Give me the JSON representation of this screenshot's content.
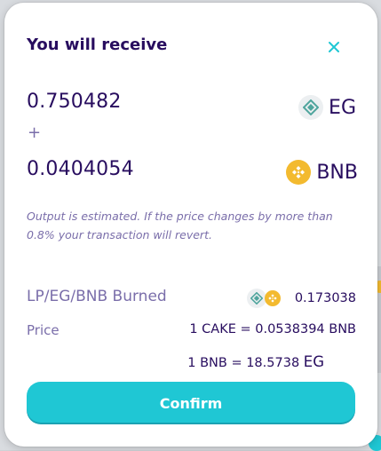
{
  "modal": {
    "title": "You will receive",
    "close_icon": "close-icon"
  },
  "receive": {
    "token_a": {
      "amount": "0.750482",
      "symbol": "EG",
      "icon": "eg-token-icon"
    },
    "plus": "+",
    "token_b": {
      "amount": "0.0404054",
      "symbol": "BNB",
      "icon": "bnb-token-icon"
    }
  },
  "note": "Output is estimated. If the price changes by more than 0.8% your transaction will revert.",
  "burned": {
    "label": "LP/EG/BNB Burned",
    "value": "0.173038",
    "icons": [
      "eg-token-icon",
      "bnb-token-icon"
    ]
  },
  "price": {
    "label": "Price",
    "line1": "1 CAKE = 0.0538394 BNB",
    "line2_prefix": "1 BNB = 18.5738",
    "line2_symbol": "EG"
  },
  "confirm_label": "Confirm",
  "colors": {
    "primary_text": "#280d5f",
    "secondary_text": "#7a6eaa",
    "accent": "#1fc7d4",
    "bnb": "#f3ba2f",
    "eg": "#4fa59d"
  }
}
